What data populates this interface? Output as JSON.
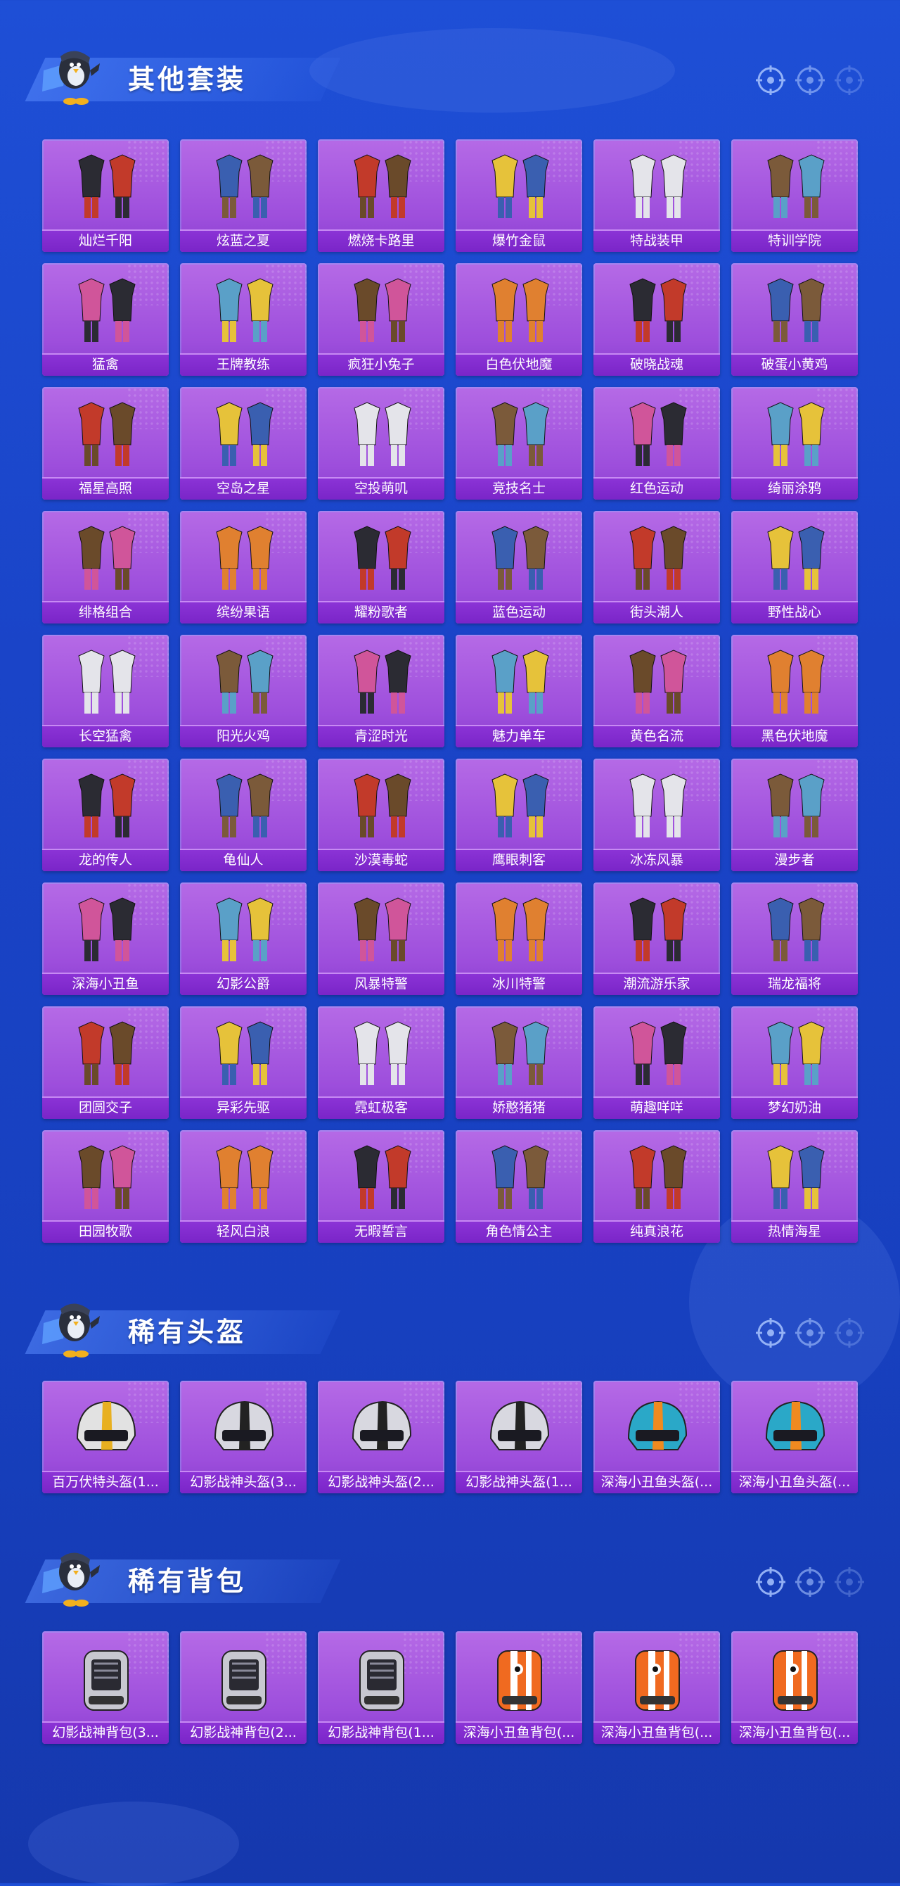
{
  "sections": [
    {
      "title": "其他套装",
      "kind": "outfit",
      "items": [
        "灿烂千阳",
        "炫蓝之夏",
        "燃烧卡路里",
        "爆竹金鼠",
        "特战装甲",
        "特训学院",
        "猛禽",
        "王牌教练",
        "疯狂小兔子",
        "白色伏地魔",
        "破晓战魂",
        "破蛋小黄鸡",
        "福星高照",
        "空岛之星",
        "空投萌叽",
        "竞技名士",
        "红色运动",
        "绮丽涂鸦",
        "绯格组合",
        "缤纷果语",
        "耀粉歌者",
        "蓝色运动",
        "街头潮人",
        "野性战心",
        "长空猛禽",
        "阳光火鸡",
        "青涩时光",
        "魅力单车",
        "黄色名流",
        "黑色伏地魔",
        "龙的传人",
        "龟仙人",
        "沙漠毒蛇",
        "鹰眼刺客",
        "冰冻风暴",
        "漫步者",
        "深海小丑鱼",
        "幻影公爵",
        "风暴特警",
        "冰川特警",
        "潮流游乐家",
        "瑞龙福将",
        "团圆交子",
        "异彩先驱",
        "霓虹极客",
        "娇憨猪猪",
        "萌趣咩咩",
        "梦幻奶油",
        "田园牧歌",
        "轻风白浪",
        "无暇誓言",
        "角色情公主",
        "纯真浪花",
        "热情海星"
      ]
    },
    {
      "title": "稀有头盔",
      "kind": "helmet",
      "items": [
        "百万伏特头盔(1...",
        "幻影战神头盔(3...",
        "幻影战神头盔(2...",
        "幻影战神头盔(1...",
        "深海小丑鱼头盔(...",
        "深海小丑鱼头盔(..."
      ]
    },
    {
      "title": "稀有背包",
      "kind": "backpack",
      "items": [
        "幻影战神背包(3...",
        "幻影战神背包(2...",
        "幻影战神背包(1...",
        "深海小丑鱼背包(...",
        "深海小丑鱼背包(...",
        "深海小丑鱼背包(..."
      ]
    }
  ],
  "icons": {
    "mascot": "penguin-mascot-icon",
    "target": "crosshair-icon"
  },
  "colors": {
    "background": "#1a44c8",
    "card": "#a556e0",
    "label": "#7f2bcc"
  }
}
